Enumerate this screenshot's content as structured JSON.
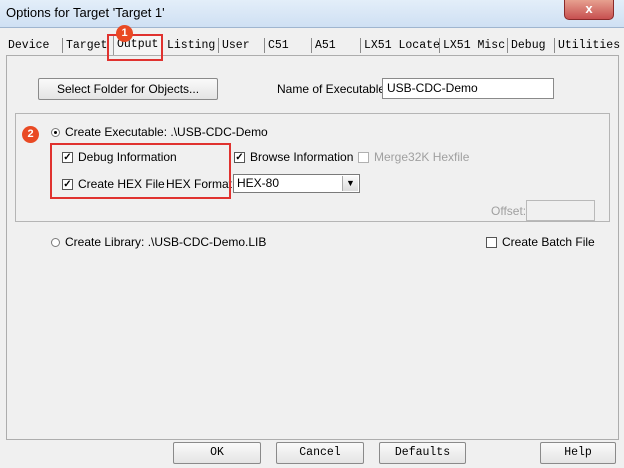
{
  "window": {
    "title": "Options for Target 'Target 1'",
    "close_glyph": "x"
  },
  "tabs": [
    {
      "label": "Device"
    },
    {
      "label": "Target"
    },
    {
      "label": "Output"
    },
    {
      "label": "Listing"
    },
    {
      "label": "User"
    },
    {
      "label": "C51"
    },
    {
      "label": "A51"
    },
    {
      "label": "LX51 Locate"
    },
    {
      "label": "LX51 Misc"
    },
    {
      "label": "Debug"
    },
    {
      "label": "Utilities"
    }
  ],
  "output": {
    "select_folder_label": "Select Folder for Objects...",
    "name_exec_label": "Name of Executable:",
    "name_exec_value": "USB-CDC-Demo",
    "create_exec_label": "Create Executable:  .\\USB-CDC-Demo",
    "debug_info_label": "Debug Information",
    "browse_info_label": "Browse Information",
    "merge_label": "Merge32K Hexfile",
    "create_hex_label": "Create HEX File",
    "hex_format_label": "HEX Format:",
    "hex_format_value": "HEX-80",
    "offset_label": "Offset:",
    "create_lib_label": "Create Library:  .\\USB-CDC-Demo.LIB",
    "batch_label": "Create Batch File"
  },
  "markers": [
    "1",
    "2"
  ],
  "buttons": {
    "ok": "OK",
    "cancel": "Cancel",
    "defaults": "Defaults",
    "help": "Help"
  },
  "colors": {
    "highlight": "#e0322f",
    "marker": "#e94a24"
  }
}
